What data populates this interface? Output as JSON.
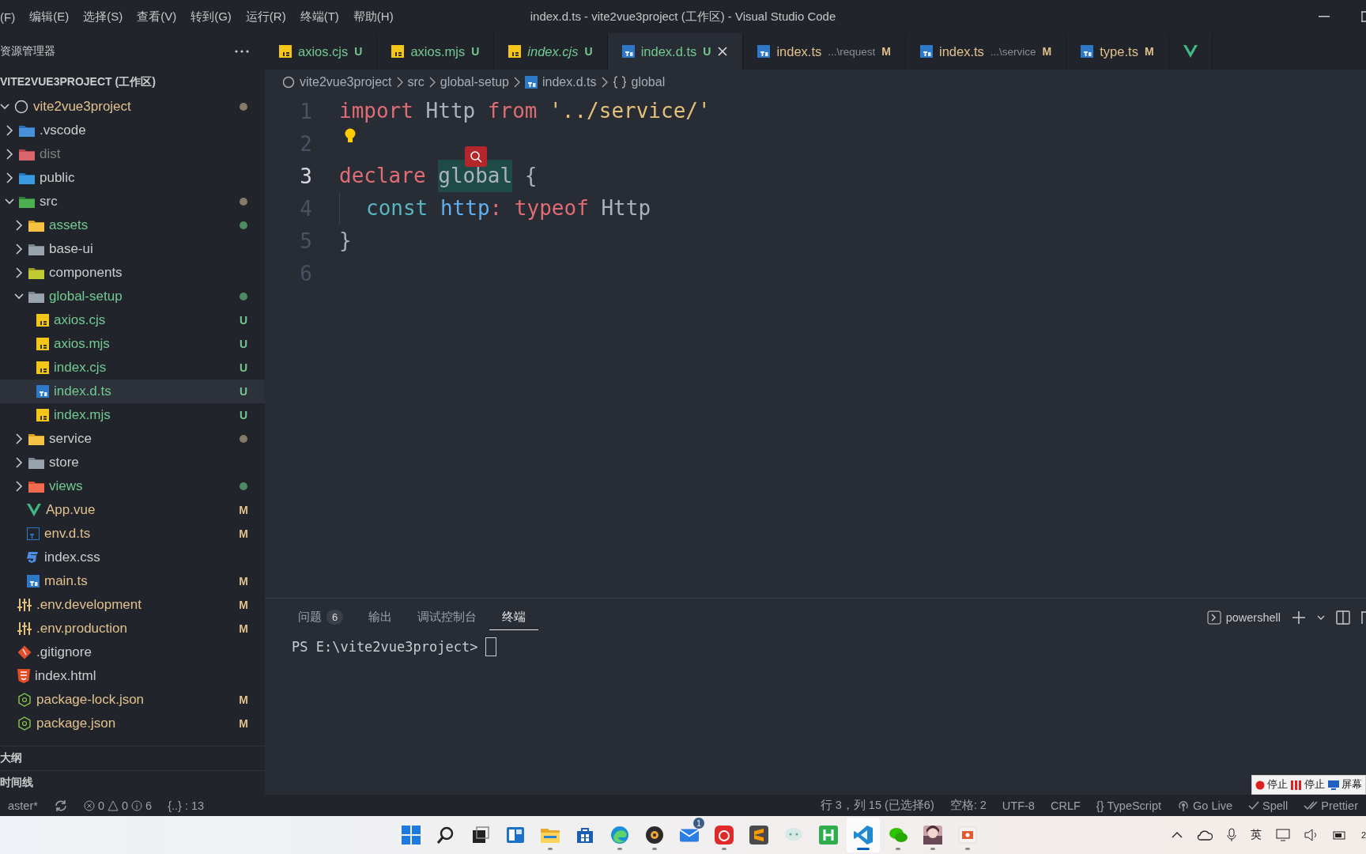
{
  "title_bar": {
    "menus": [
      "(F)",
      "编辑(E)",
      "选择(S)",
      "查看(V)",
      "转到(G)",
      "运行(R)",
      "终端(T)",
      "帮助(H)"
    ],
    "title": "index.d.ts - vite2vue3project (工作区) - Visual Studio Code"
  },
  "sidebar": {
    "title": "资源管理器",
    "section": "VITE2VUE3PROJECT (工作区)",
    "tree": [
      {
        "name": "vite2vue3project",
        "kind": "root",
        "color": "#e2c08d",
        "dot": {
          "color": "#857a68"
        },
        "expanded": true,
        "selected": false,
        "children": [
          {
            "name": ".vscode",
            "kind": "vscode-folder",
            "color": "#cccccc",
            "expanded": false,
            "selected": false
          },
          {
            "name": "dist",
            "kind": "dist-folder",
            "color": "#7e7e7e",
            "expanded": false,
            "selected": false
          },
          {
            "name": "public",
            "kind": "public-folder",
            "color": "#cccccc",
            "expanded": false,
            "selected": false
          },
          {
            "name": "src",
            "kind": "src-folder",
            "color": "#cccccc",
            "dot": {
              "color": "#857a68"
            },
            "expanded": true,
            "selected": false,
            "children": [
              {
                "name": "assets",
                "kind": "assets-folder",
                "color": "#73c991",
                "dot": {
                  "color": "#4e8a62"
                },
                "expanded": false,
                "selected": false
              },
              {
                "name": "base-ui",
                "kind": "folder",
                "color": "#cccccc",
                "expanded": false,
                "selected": false
              },
              {
                "name": "components",
                "kind": "components-folder",
                "color": "#cccccc",
                "expanded": false,
                "selected": false
              },
              {
                "name": "global-setup",
                "kind": "folder",
                "color": "#73c991",
                "dot": {
                  "color": "#4e8a62"
                },
                "expanded": true,
                "selected": false,
                "children": [
                  {
                    "name": "axios.cjs",
                    "kind": "js",
                    "color": "#73c991",
                    "badge": "U",
                    "selected": false
                  },
                  {
                    "name": "axios.mjs",
                    "kind": "js",
                    "color": "#73c991",
                    "badge": "U",
                    "selected": false
                  },
                  {
                    "name": "index.cjs",
                    "kind": "js",
                    "color": "#73c991",
                    "badge": "U",
                    "selected": false
                  },
                  {
                    "name": "index.d.ts",
                    "kind": "ts",
                    "color": "#73c991",
                    "badge": "U",
                    "selected": true
                  },
                  {
                    "name": "index.mjs",
                    "kind": "js",
                    "color": "#73c991",
                    "badge": "U",
                    "selected": false
                  }
                ]
              },
              {
                "name": "service",
                "kind": "service-folder",
                "color": "#cccccc",
                "dot": {
                  "color": "#857a68"
                },
                "expanded": false,
                "selected": false
              },
              {
                "name": "store",
                "kind": "folder",
                "color": "#cccccc",
                "expanded": false,
                "selected": false
              },
              {
                "name": "views",
                "kind": "views-folder",
                "color": "#73c991",
                "dot": {
                  "color": "#4e8a62"
                },
                "expanded": false,
                "selected": false
              },
              {
                "name": "App.vue",
                "kind": "vue",
                "color": "#e2c08d",
                "badge": "M",
                "selected": false
              },
              {
                "name": "env.d.ts",
                "kind": "ts-outline",
                "color": "#e2c08d",
                "badge": "M",
                "selected": false
              },
              {
                "name": "index.css",
                "kind": "css",
                "color": "#cccccc",
                "selected": false
              },
              {
                "name": "main.ts",
                "kind": "ts",
                "color": "#e2c08d",
                "badge": "M",
                "selected": false
              }
            ]
          },
          {
            "name": ".env.development",
            "kind": "env",
            "color": "#e2c08d",
            "badge": "M",
            "selected": false
          },
          {
            "name": ".env.production",
            "kind": "env",
            "color": "#e2c08d",
            "badge": "M",
            "selected": false
          },
          {
            "name": ".gitignore",
            "kind": "git",
            "color": "#cccccc",
            "selected": false
          },
          {
            "name": "index.html",
            "kind": "html",
            "color": "#cccccc",
            "selected": false
          },
          {
            "name": "package-lock.json",
            "kind": "node",
            "color": "#e2c08d",
            "badge": "M",
            "selected": false
          },
          {
            "name": "package.json",
            "kind": "node",
            "color": "#e2c08d",
            "badge": "M",
            "selected": false
          }
        ]
      }
    ],
    "panels": [
      "大纲",
      "时间线"
    ]
  },
  "tabs": [
    {
      "name": "axios.cjs",
      "kind": "js",
      "badge": "U",
      "color": "#73c991",
      "italic": false,
      "selected": false
    },
    {
      "name": "axios.mjs",
      "kind": "js",
      "badge": "U",
      "color": "#73c991",
      "italic": false,
      "selected": false
    },
    {
      "name": "index.cjs",
      "kind": "js",
      "badge": "U",
      "color": "#73c991",
      "italic": true,
      "selected": false
    },
    {
      "name": "index.d.ts",
      "kind": "ts",
      "badge": "U",
      "color": "#73c991",
      "italic": false,
      "selected": true
    },
    {
      "name": "index.ts",
      "detail": "...\\request",
      "kind": "ts",
      "badge": "M",
      "color": "#e2c08d",
      "italic": false,
      "selected": false
    },
    {
      "name": "index.ts",
      "detail": "...\\service",
      "kind": "ts",
      "badge": "M",
      "color": "#e2c08d",
      "italic": false,
      "selected": false
    },
    {
      "name": "type.ts",
      "kind": "ts",
      "badge": "M",
      "color": "#e2c08d",
      "italic": false,
      "selected": false
    }
  ],
  "breadcrumb": [
    {
      "text": "vite2vue3project",
      "kind": "circle"
    },
    {
      "text": "src",
      "kind": "plain"
    },
    {
      "text": "global-setup",
      "kind": "plain"
    },
    {
      "text": "index.d.ts",
      "kind": "ts"
    },
    {
      "text": "global",
      "kind": "braces"
    }
  ],
  "editor": {
    "lines": [
      {
        "number": "1",
        "current": false,
        "tokens": [
          {
            "text": "import",
            "kind": "keyword"
          },
          {
            "text": " Http ",
            "kind": "ident"
          },
          {
            "text": "from",
            "kind": "keyword"
          },
          {
            "text": " '../service/'",
            "kind": "string"
          }
        ]
      },
      {
        "number": "2",
        "current": false,
        "lightbulb": true
      },
      {
        "number": "3",
        "current": true,
        "tokens": [
          {
            "text": "declare ",
            "kind": "keyword"
          },
          {
            "text": "global",
            "kind": "ident",
            "highlighted": true
          },
          {
            "text": " {",
            "kind": "ident"
          }
        ]
      },
      {
        "number": "4",
        "current": false,
        "indented": true,
        "tokens": [
          {
            "text": "const ",
            "kind": "storage"
          },
          {
            "text": "http",
            "kind": "variable"
          },
          {
            "text": ": ",
            "kind": "keyword"
          },
          {
            "text": "typeof",
            "kind": "keyword"
          },
          {
            "text": " Http",
            "kind": "ident"
          }
        ]
      },
      {
        "number": "5",
        "current": false,
        "tokens": [
          {
            "text": "}",
            "kind": "ident"
          }
        ]
      },
      {
        "number": "6",
        "current": false
      }
    ]
  },
  "panel": {
    "tabs": [
      {
        "label": "问题",
        "count": "6",
        "selected": false
      },
      {
        "label": "输出",
        "selected": false
      },
      {
        "label": "调试控制台",
        "selected": false
      },
      {
        "label": "终端",
        "selected": true
      }
    ],
    "shell": "powershell",
    "terminal": {
      "prompt": "PS E:\\vite2vue3project>"
    }
  },
  "status_bar": {
    "branch": "aster*",
    "errors": "0",
    "warnings": "0",
    "infos": "6",
    "extra": "{..} : 13",
    "right": [
      {
        "kind": "plain",
        "text": "行 3，列 15 (已选择6)"
      },
      {
        "kind": "plain",
        "text": "空格: 2"
      },
      {
        "kind": "plain",
        "text": "UTF-8"
      },
      {
        "kind": "plain",
        "text": "CRLF"
      },
      {
        "kind": "plain",
        "glyph": "{}",
        "text": "TypeScript"
      },
      {
        "kind": "broadcast",
        "text": "Go Live"
      },
      {
        "kind": "check",
        "text": "Spell"
      },
      {
        "kind": "double-check",
        "text": "Prettier"
      }
    ]
  },
  "recorder": [
    {
      "kind": "dot",
      "text": "停止"
    },
    {
      "kind": "bars",
      "text": "停止"
    },
    {
      "kind": "screen",
      "text": "屏幕"
    }
  ],
  "taskbar": {
    "apps": [
      {
        "kind": "start",
        "running": false,
        "active": false
      },
      {
        "kind": "search",
        "running": false,
        "active": false
      },
      {
        "kind": "taskview",
        "running": false,
        "active": false
      },
      {
        "kind": "widgets",
        "running": false,
        "active": false
      },
      {
        "kind": "explorer",
        "running": true,
        "active": false
      },
      {
        "kind": "store",
        "running": false,
        "active": false
      },
      {
        "kind": "edge",
        "running": true,
        "active": false
      },
      {
        "kind": "music",
        "running": true,
        "active": false
      },
      {
        "kind": "mail",
        "badge": "1",
        "running": false,
        "active": false
      },
      {
        "kind": "netease",
        "running": true,
        "active": false
      },
      {
        "kind": "sublime",
        "running": false,
        "active": false
      },
      {
        "kind": "chat",
        "running": false,
        "active": false
      },
      {
        "kind": "hbuilder",
        "running": false,
        "active": false
      },
      {
        "kind": "vscode",
        "running": true,
        "active": true
      },
      {
        "kind": "wechat",
        "running": true,
        "active": false
      },
      {
        "kind": "picture",
        "running": true,
        "active": false
      },
      {
        "kind": "slides",
        "running": true,
        "active": false
      }
    ],
    "tray": {
      "ime": "英",
      "clock": "2"
    }
  }
}
